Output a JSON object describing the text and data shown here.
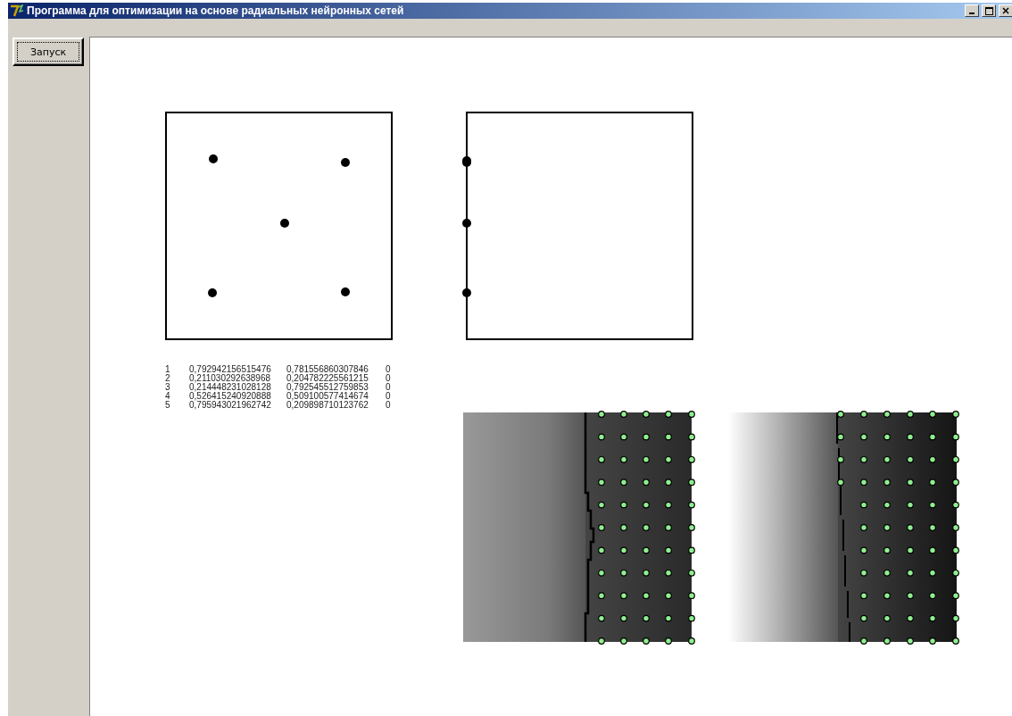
{
  "window": {
    "title": "Программа для оптимизации на основе радиальных нейронных сетей"
  },
  "run_button": {
    "label": "Запуск"
  },
  "table": {
    "rows": [
      [
        "1",
        "0,792942156515476",
        "0,781556860307846",
        "0"
      ],
      [
        "2",
        "0,211030292638968",
        "0,204782225561215",
        "0"
      ],
      [
        "3",
        "0,214448231028128",
        "0,792545512759853",
        "0"
      ],
      [
        "4",
        "0,526415240920888",
        "0,509100577414674",
        "0"
      ],
      [
        "5",
        "0,795943021962742",
        "0,209898710123762",
        "0"
      ]
    ]
  }
}
